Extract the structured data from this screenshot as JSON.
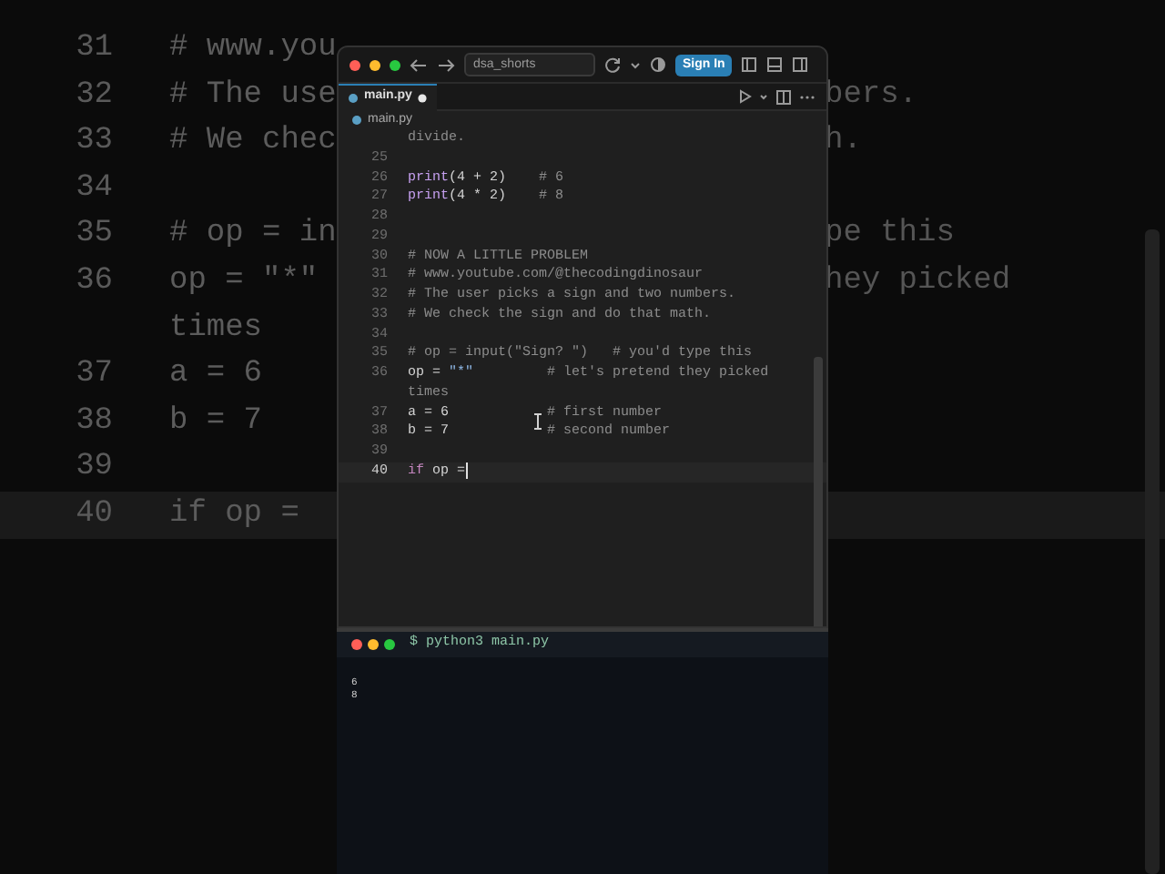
{
  "background": {
    "rows": [
      {
        "number": "31",
        "text": "# www.you"
      },
      {
        "number": "32",
        "text": "# The use",
        "tail": "bers."
      },
      {
        "number": "33",
        "text": "# We chec",
        "tail": "h."
      },
      {
        "number": "34"
      },
      {
        "number": "35",
        "text": "# op = in",
        "tail": "pe this"
      },
      {
        "number": "36",
        "text": "op = \"*\"",
        "tail": "hey picked"
      },
      {
        "text": "times"
      },
      {
        "number": "37",
        "text": "a = 6"
      },
      {
        "number": "38",
        "text": "b = 7"
      },
      {
        "number": "39"
      },
      {
        "number": "40",
        "text": "if op =",
        "current": true
      }
    ]
  },
  "editor": {
    "title_bar": {
      "project": "dsa_shorts",
      "sign_in": "Sign In"
    },
    "tab": {
      "label": "main.py",
      "modified": true
    },
    "breadcrumb": "main.py",
    "rows": [
      {
        "tokens": [
          {
            "text": "divide.",
            "kind": "comment"
          }
        ],
        "current": false
      },
      {
        "number": "25",
        "current": false
      },
      {
        "number": "26",
        "tokens": [
          {
            "text": "print",
            "kind": "func"
          },
          {
            "text": "(4 + 2)",
            "kind": "plain"
          },
          {
            "text": "    # 6",
            "kind": "comment"
          }
        ],
        "current": false
      },
      {
        "number": "27",
        "tokens": [
          {
            "text": "print",
            "kind": "func"
          },
          {
            "text": "(4 * 2)",
            "kind": "plain"
          },
          {
            "text": "    # 8",
            "kind": "comment"
          }
        ],
        "current": false
      },
      {
        "number": "28",
        "current": false
      },
      {
        "number": "29",
        "current": false
      },
      {
        "number": "30",
        "tokens": [
          {
            "text": "# NOW A LITTLE PROBLEM",
            "kind": "comment"
          }
        ],
        "current": false
      },
      {
        "number": "31",
        "tokens": [
          {
            "text": "# www.youtube.com/@thecodingdinosaur",
            "kind": "comment"
          }
        ],
        "current": false
      },
      {
        "number": "32",
        "tokens": [
          {
            "text": "# The user picks a sign and two numbers.",
            "kind": "comment"
          }
        ],
        "current": false
      },
      {
        "number": "33",
        "tokens": [
          {
            "text": "# We check the sign and do that math.",
            "kind": "comment"
          }
        ],
        "current": false
      },
      {
        "number": "34",
        "current": false
      },
      {
        "number": "35",
        "tokens": [
          {
            "text": "# op = input(\"Sign? \")   # you'd type this",
            "kind": "comment"
          }
        ],
        "current": false
      },
      {
        "number": "36",
        "tokens": [
          {
            "text": "op = ",
            "kind": "plain"
          },
          {
            "text": "\"*\"",
            "kind": "string"
          },
          {
            "text": "         # let's pretend they picked",
            "kind": "comment"
          }
        ],
        "current": false
      },
      {
        "tokens": [
          {
            "text": "times",
            "kind": "comment"
          }
        ],
        "current": false
      },
      {
        "number": "37",
        "tokens": [
          {
            "text": "a = 6",
            "kind": "plain"
          },
          {
            "text": "            # first number",
            "kind": "comment"
          }
        ],
        "current": false
      },
      {
        "number": "38",
        "tokens": [
          {
            "text": "b = 7",
            "kind": "plain"
          },
          {
            "text": "            # second number",
            "kind": "comment"
          }
        ],
        "current": false
      },
      {
        "number": "39",
        "current": false
      },
      {
        "number": "40",
        "tokens": [
          {
            "text": "if",
            "kind": "keyword"
          },
          {
            "text": " op =",
            "kind": "plain"
          }
        ],
        "current": true
      }
    ]
  },
  "terminal": {
    "command": "$ python3 main.py",
    "output": [
      "6",
      "8"
    ]
  }
}
